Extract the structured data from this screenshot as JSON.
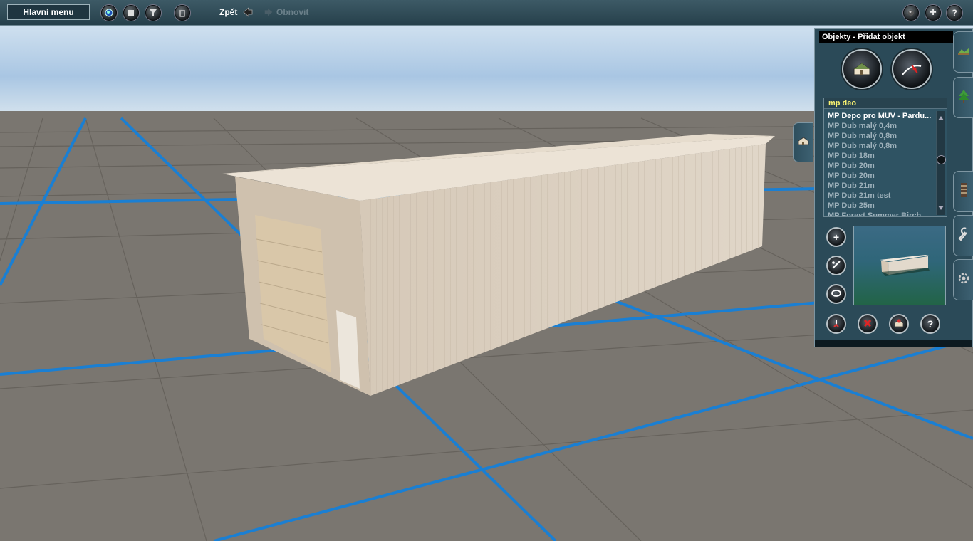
{
  "toolbar": {
    "menu_label": "Hlavní menu",
    "back_label": "Zpět",
    "redo_label": "Obnovit",
    "left_icons": [
      "globe-icon",
      "stop-icon",
      "filter-icon",
      "trash-icon"
    ],
    "right_icons": [
      "sphere-icon",
      "add-icon",
      "help-icon"
    ],
    "help_glyph": "?",
    "add_glyph": "+"
  },
  "panel": {
    "title": "Objekty - Přidat objekt",
    "search_text": "mp deo",
    "items": [
      "MP Depo pro MUV - Pardu...",
      "MP Dub malý 0,4m",
      "MP Dub malý 0,8m",
      "MP Dub malý 0,8m",
      "MP Dub 18m",
      "MP Dub 20m",
      "MP Dub 20m",
      "MP Dub 21m",
      "MP Dub 21m test",
      "MP Dub 25m",
      "MP Forest Summer Birch ..."
    ],
    "selected_index": 0,
    "help_glyph": "?",
    "add_glyph": "+"
  },
  "colors": {
    "sky_top": "#cfe0ef",
    "ground": "#7a7670",
    "grid_blue": "#1a7fd3",
    "building": "#d8cbbb"
  }
}
